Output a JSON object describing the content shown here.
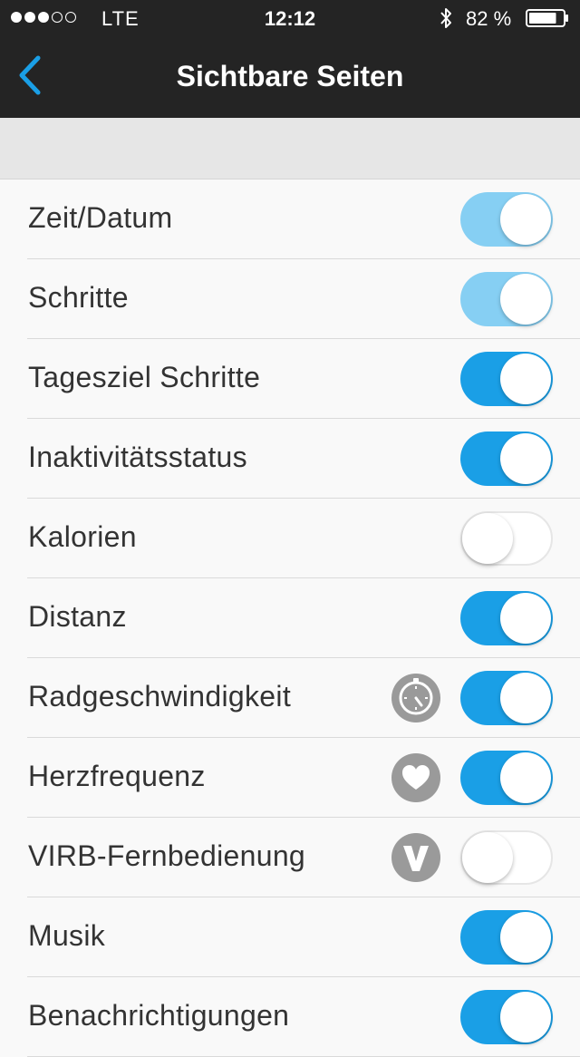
{
  "status_bar": {
    "signal_dots": [
      true,
      true,
      true,
      false,
      false
    ],
    "carrier": "LTE",
    "time": "12:12",
    "battery_percent": "82 %",
    "battery_level": 0.82
  },
  "nav": {
    "back_icon": "chevron-left-icon",
    "title": "Sichtbare Seiten",
    "accent_color": "#1a9fe6"
  },
  "pages": [
    {
      "label": "Zeit/Datum",
      "enabled": true,
      "locked": true,
      "icon": null
    },
    {
      "label": "Schritte",
      "enabled": true,
      "locked": true,
      "icon": null
    },
    {
      "label": "Tagesziel Schritte",
      "enabled": true,
      "locked": false,
      "icon": null
    },
    {
      "label": "Inaktivitätsstatus",
      "enabled": true,
      "locked": false,
      "icon": null
    },
    {
      "label": "Kalorien",
      "enabled": false,
      "locked": false,
      "icon": null
    },
    {
      "label": "Distanz",
      "enabled": true,
      "locked": false,
      "icon": null
    },
    {
      "label": "Radgeschwindigkeit",
      "enabled": true,
      "locked": false,
      "icon": "speed-sensor-icon"
    },
    {
      "label": "Herzfrequenz",
      "enabled": true,
      "locked": false,
      "icon": "heart-icon"
    },
    {
      "label": "VIRB-Fernbedienung",
      "enabled": false,
      "locked": false,
      "icon": "virb-icon"
    },
    {
      "label": "Musik",
      "enabled": true,
      "locked": false,
      "icon": null
    },
    {
      "label": "Benachrichtigungen",
      "enabled": true,
      "locked": false,
      "icon": null
    }
  ]
}
